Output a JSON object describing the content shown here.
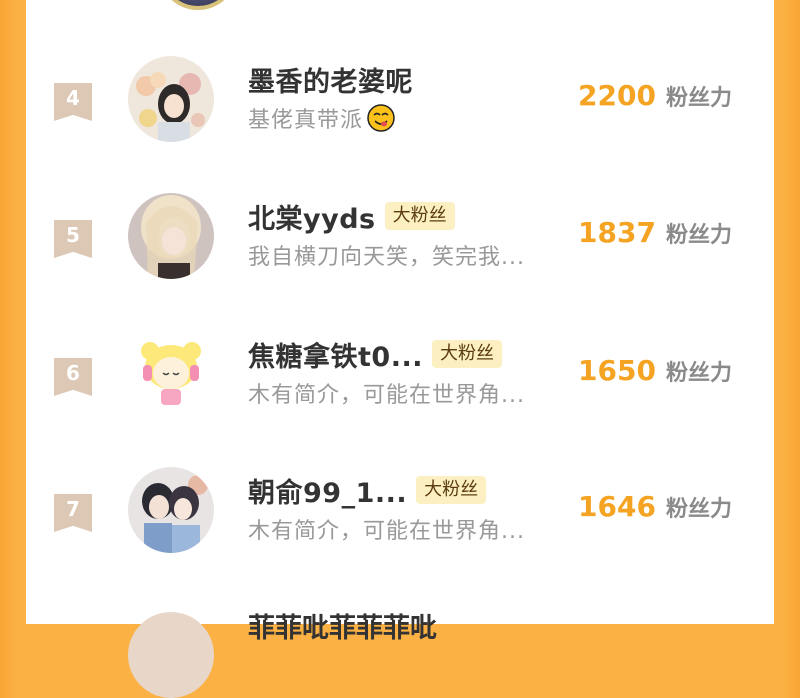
{
  "ranking": {
    "rows": [
      {
        "rank": "4",
        "name": "墨香的老婆呢",
        "badge": "",
        "bio": "基佬真带派",
        "fans_count": "2200",
        "fans_label": "粉丝力",
        "has_emoji": true
      },
      {
        "rank": "5",
        "name": "北棠yyds",
        "badge": "大粉丝",
        "bio": "我自横刀向天笑，笑完我...",
        "fans_count": "1837",
        "fans_label": "粉丝力",
        "has_emoji": false
      },
      {
        "rank": "6",
        "name": "焦糖拿铁t0...",
        "badge": "大粉丝",
        "bio": "木有简介，可能在世界角...",
        "fans_count": "1650",
        "fans_label": "粉丝力",
        "has_emoji": false
      },
      {
        "rank": "7",
        "name": "朝俞99_1...",
        "badge": "大粉丝",
        "bio": "木有简介，可能在世界角...",
        "fans_count": "1646",
        "fans_label": "粉丝力",
        "has_emoji": false
      }
    ],
    "next_partial_name": "菲菲吡菲菲菲吡"
  },
  "colors": {
    "accent_orange": "#f5a322",
    "background_orange": "#fbb143",
    "badge_bg": "#fcefc1",
    "rank_tag": "#dcc8b5"
  },
  "icons": {
    "rank_tag": "ribbon-tag-icon",
    "bio_emoji": "yum-face-emoji-icon"
  }
}
